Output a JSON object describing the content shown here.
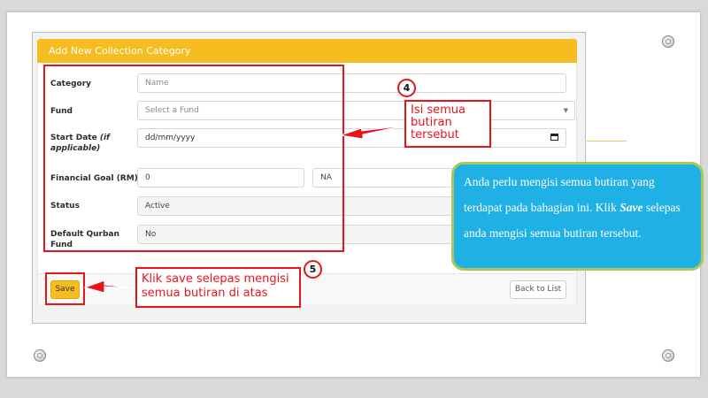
{
  "form": {
    "header_title": "Add New Collection Category",
    "fields": {
      "category": {
        "label": "Category",
        "placeholder": "Name"
      },
      "fund": {
        "label": "Fund",
        "value": "Select a Fund"
      },
      "start_date": {
        "label": "Start Date",
        "label_note": "(if applicable)",
        "placeholder": "dd/mm/yyyy"
      },
      "financial_goal": {
        "label": "Financial Goal (RM)",
        "value": "0",
        "secondary_value": "NA"
      },
      "status": {
        "label": "Status",
        "value": "Active"
      },
      "default_qurban": {
        "label_line1": "Default Qurban",
        "label_line2": "Fund",
        "value": "No"
      }
    },
    "save_label": "Save",
    "back_label": "Back to List"
  },
  "annotations": {
    "step4_number": "4",
    "step4_line1": "Isi semua",
    "step4_line2": "butiran",
    "step4_line3": "tersebut",
    "step5_number": "5",
    "step5_line1": "Klik save selepas mengisi",
    "step5_line2": "semua butiran di atas",
    "note_part1": "Anda perlu mengisi semua butiran yang terdapat pada bahagian ini. Klik ",
    "note_bold": "Save",
    "note_part2": " selepas anda mengisi semua butiran tersebut.",
    "accent_red": "#e8141b",
    "note_bg": "#1fb0e6"
  },
  "colors": {
    "header": "#f5bd1f"
  }
}
